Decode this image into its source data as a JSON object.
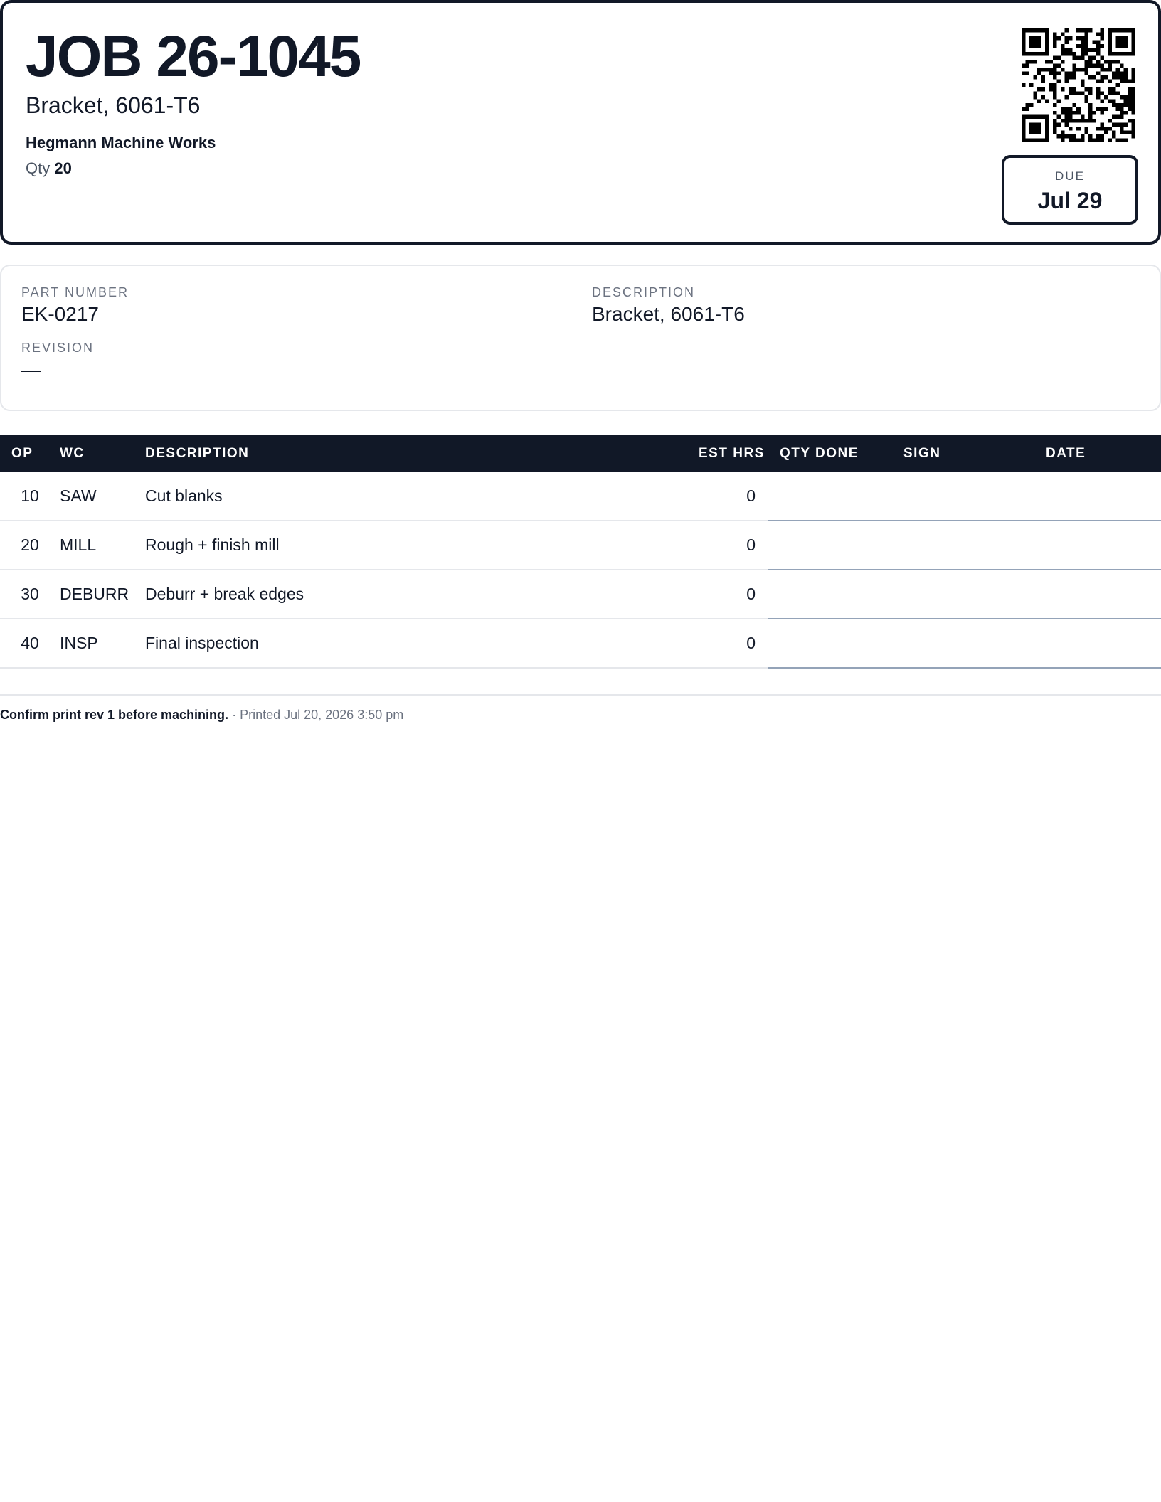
{
  "header": {
    "job_title": "JOB 26-1045",
    "subtitle": "Bracket, 6061-T6",
    "customer": "Hegmann Machine Works",
    "qty_label": "Qty",
    "qty_value": "20",
    "due_label": "DUE",
    "due_value": "Jul 29"
  },
  "part": {
    "part_number_label": "PART NUMBER",
    "part_number": "EK-0217",
    "description_label": "DESCRIPTION",
    "description": "Bracket, 6061-T6",
    "revision_label": "REVISION",
    "revision": "—"
  },
  "operations": {
    "columns": [
      "OP",
      "WC",
      "DESCRIPTION",
      "EST HRS",
      "QTY DONE",
      "SIGN",
      "DATE"
    ],
    "rows": [
      {
        "op": "10",
        "wc": "SAW",
        "description": "Cut blanks",
        "est_hrs": "0"
      },
      {
        "op": "20",
        "wc": "MILL",
        "description": "Rough + finish mill",
        "est_hrs": "0"
      },
      {
        "op": "30",
        "wc": "DEBURR",
        "description": "Deburr + break edges",
        "est_hrs": "0"
      },
      {
        "op": "40",
        "wc": "INSP",
        "description": "Final inspection",
        "est_hrs": "0"
      }
    ]
  },
  "footer": {
    "note": "Confirm print rev 1 before machining.",
    "separator": "·",
    "printed": "Printed Jul 20, 2026 3:50 pm"
  },
  "colors": {
    "ink": "#111827",
    "muted": "#6b7280",
    "rule": "#e5e7eb",
    "signature_line": "#94a3b8"
  },
  "icons": [
    "qr-code-icon"
  ]
}
